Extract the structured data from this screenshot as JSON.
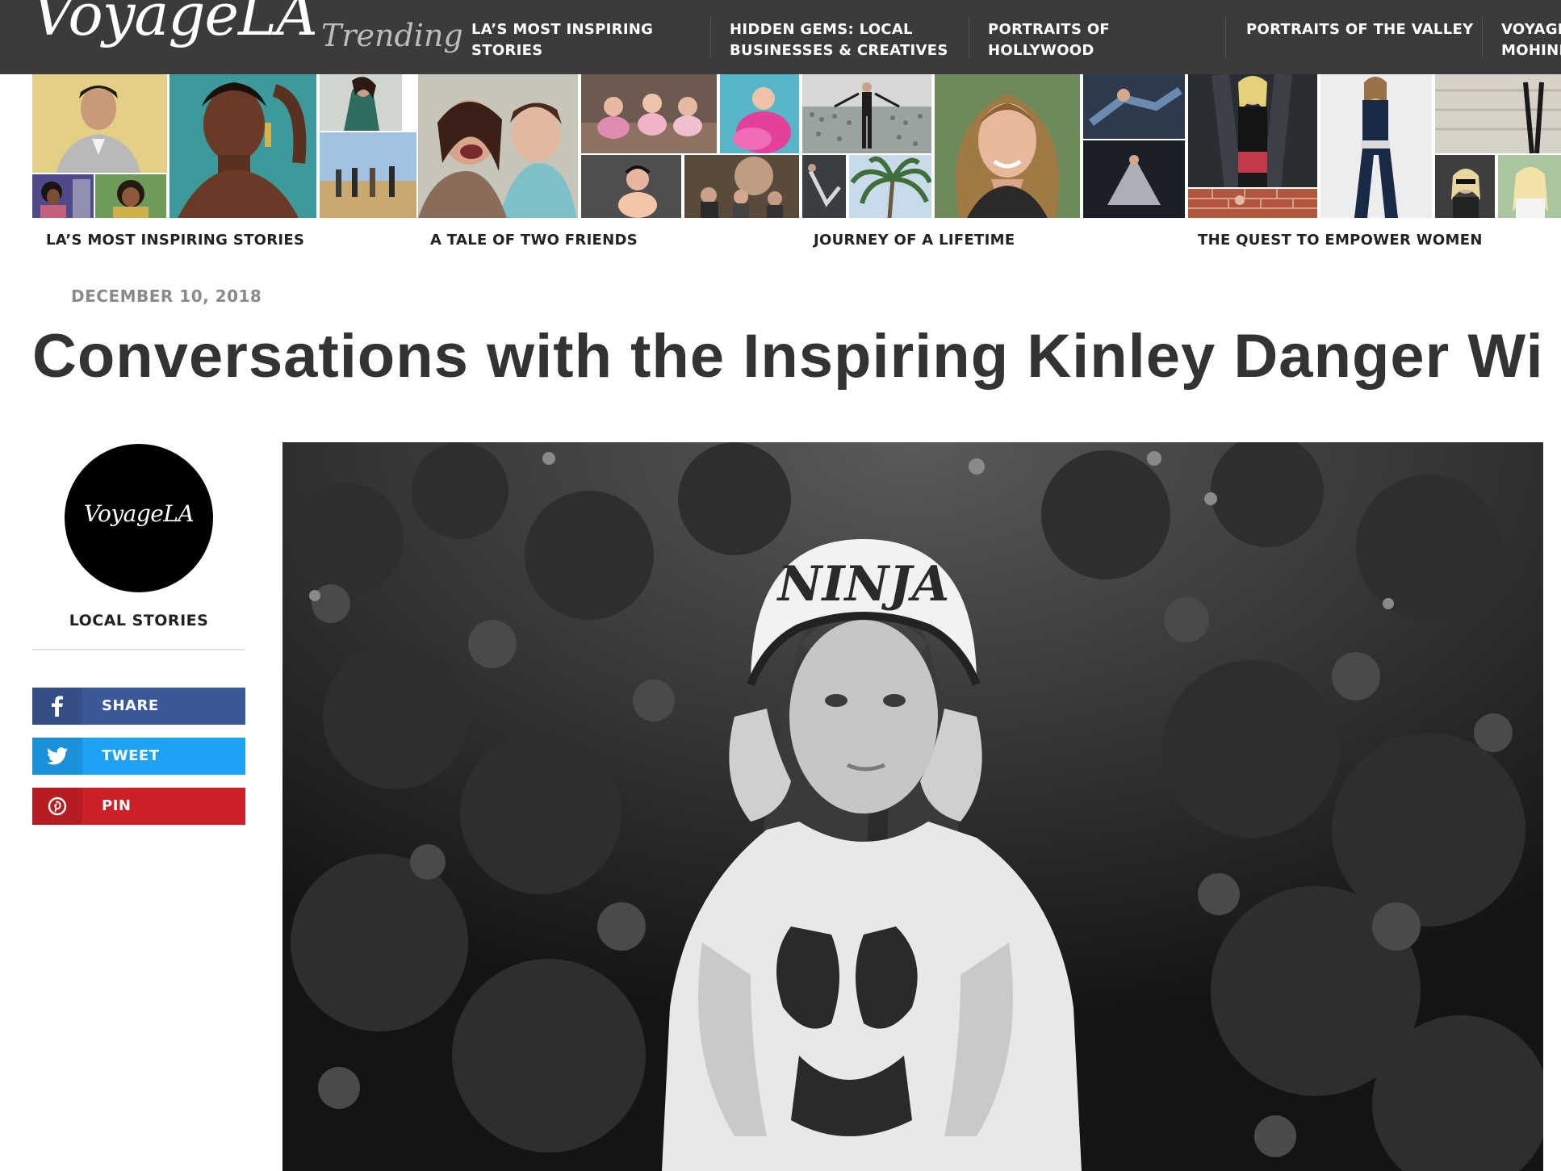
{
  "site": {
    "logo": "VoyageLA",
    "trending_label": "Trending"
  },
  "nav": {
    "items": [
      {
        "label": "LA’S MOST INSPIRING\nSTORIES"
      },
      {
        "label": "HIDDEN GEMS: LOCAL\nBUSINESSES & CREATIVES"
      },
      {
        "label": "PORTRAITS OF\nHOLLYWOOD"
      },
      {
        "label": "PORTRAITS OF THE VALLEY"
      },
      {
        "label": "VOYAGE\nMOHINI"
      }
    ]
  },
  "trending_strip": {
    "captions": [
      "LA’S MOST INSPIRING STORIES",
      "A TALE OF TWO FRIENDS",
      "JOURNEY OF A LIFETIME",
      "THE QUEST TO EMPOWER WOMEN"
    ]
  },
  "article": {
    "date": "DECEMBER 10, 2018",
    "title": "Conversations with the Inspiring Kinley Danger Wi"
  },
  "sidebar": {
    "badge_text": "VoyageLA",
    "section_label": "LOCAL STORIES",
    "share": [
      {
        "label": "SHARE",
        "icon": "facebook-icon",
        "color": "#3b5998"
      },
      {
        "label": "TWEET",
        "icon": "twitter-icon",
        "color": "#1da1f2"
      },
      {
        "label": "PIN",
        "icon": "pinterest-icon",
        "color": "#cb2027"
      }
    ]
  },
  "hero": {
    "helmet_text": "NINJA"
  }
}
